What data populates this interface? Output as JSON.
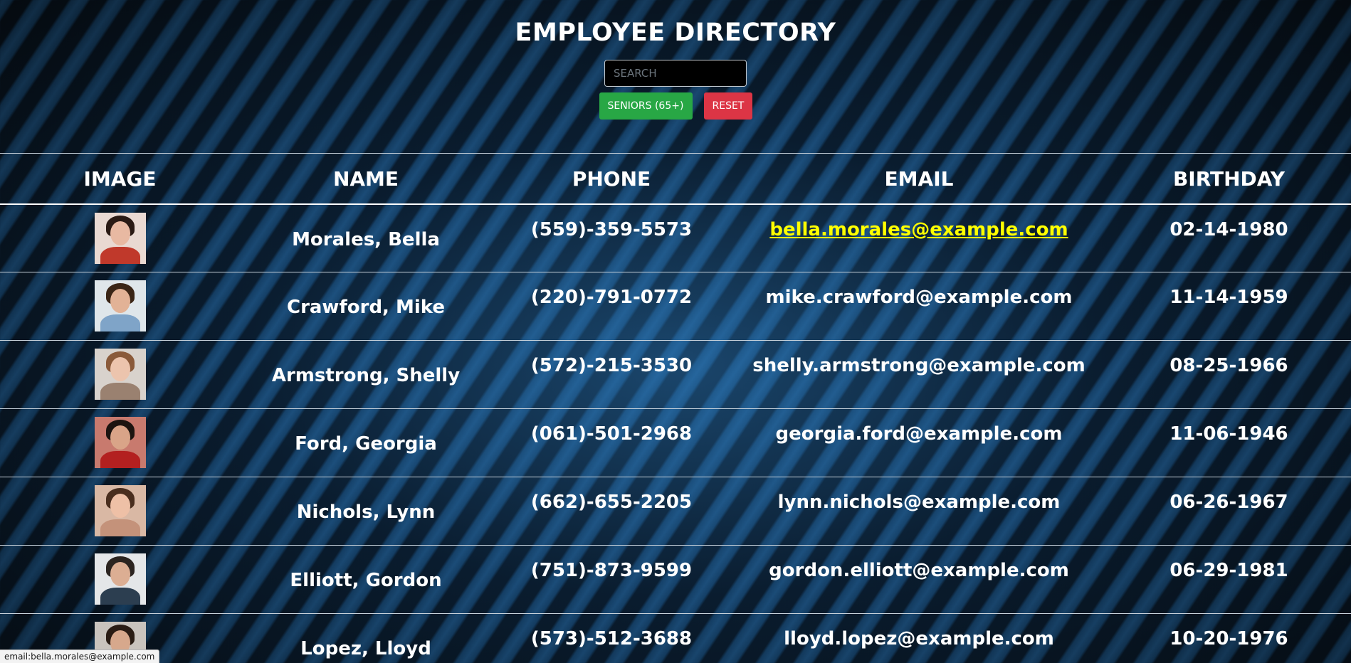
{
  "header": {
    "title": "EMPLOYEE DIRECTORY",
    "search_placeholder": "SEARCH",
    "seniors_label": "SENIORS (65+)",
    "reset_label": "RESET"
  },
  "table": {
    "columns": [
      "IMAGE",
      "NAME",
      "PHONE",
      "EMAIL",
      "BIRTHDAY"
    ],
    "rows": [
      {
        "name": "Morales, Bella",
        "phone": "(559)-359-5573",
        "email": "bella.morales@example.com",
        "birthday": "02-14-1980",
        "hover": true
      },
      {
        "name": "Crawford, Mike",
        "phone": "(220)-791-0772",
        "email": "mike.crawford@example.com",
        "birthday": "11-14-1959"
      },
      {
        "name": "Armstrong, Shelly",
        "phone": "(572)-215-3530",
        "email": "shelly.armstrong@example.com",
        "birthday": "08-25-1966"
      },
      {
        "name": "Ford, Georgia",
        "phone": "(061)-501-2968",
        "email": "georgia.ford@example.com",
        "birthday": "11-06-1946"
      },
      {
        "name": "Nichols, Lynn",
        "phone": "(662)-655-2205",
        "email": "lynn.nichols@example.com",
        "birthday": "06-26-1967"
      },
      {
        "name": "Elliott, Gordon",
        "phone": "(751)-873-9599",
        "email": "gordon.elliott@example.com",
        "birthday": "06-29-1981"
      },
      {
        "name": "Lopez, Lloyd",
        "phone": "(573)-512-3688",
        "email": "lloyd.lopez@example.com",
        "birthday": "10-20-1976"
      }
    ]
  },
  "status_bar": {
    "text": "email:bella.morales@example.com"
  },
  "colors": {
    "seniors_button": "#28a745",
    "reset_button": "#dc3545",
    "link_hover": "#ffff00"
  }
}
